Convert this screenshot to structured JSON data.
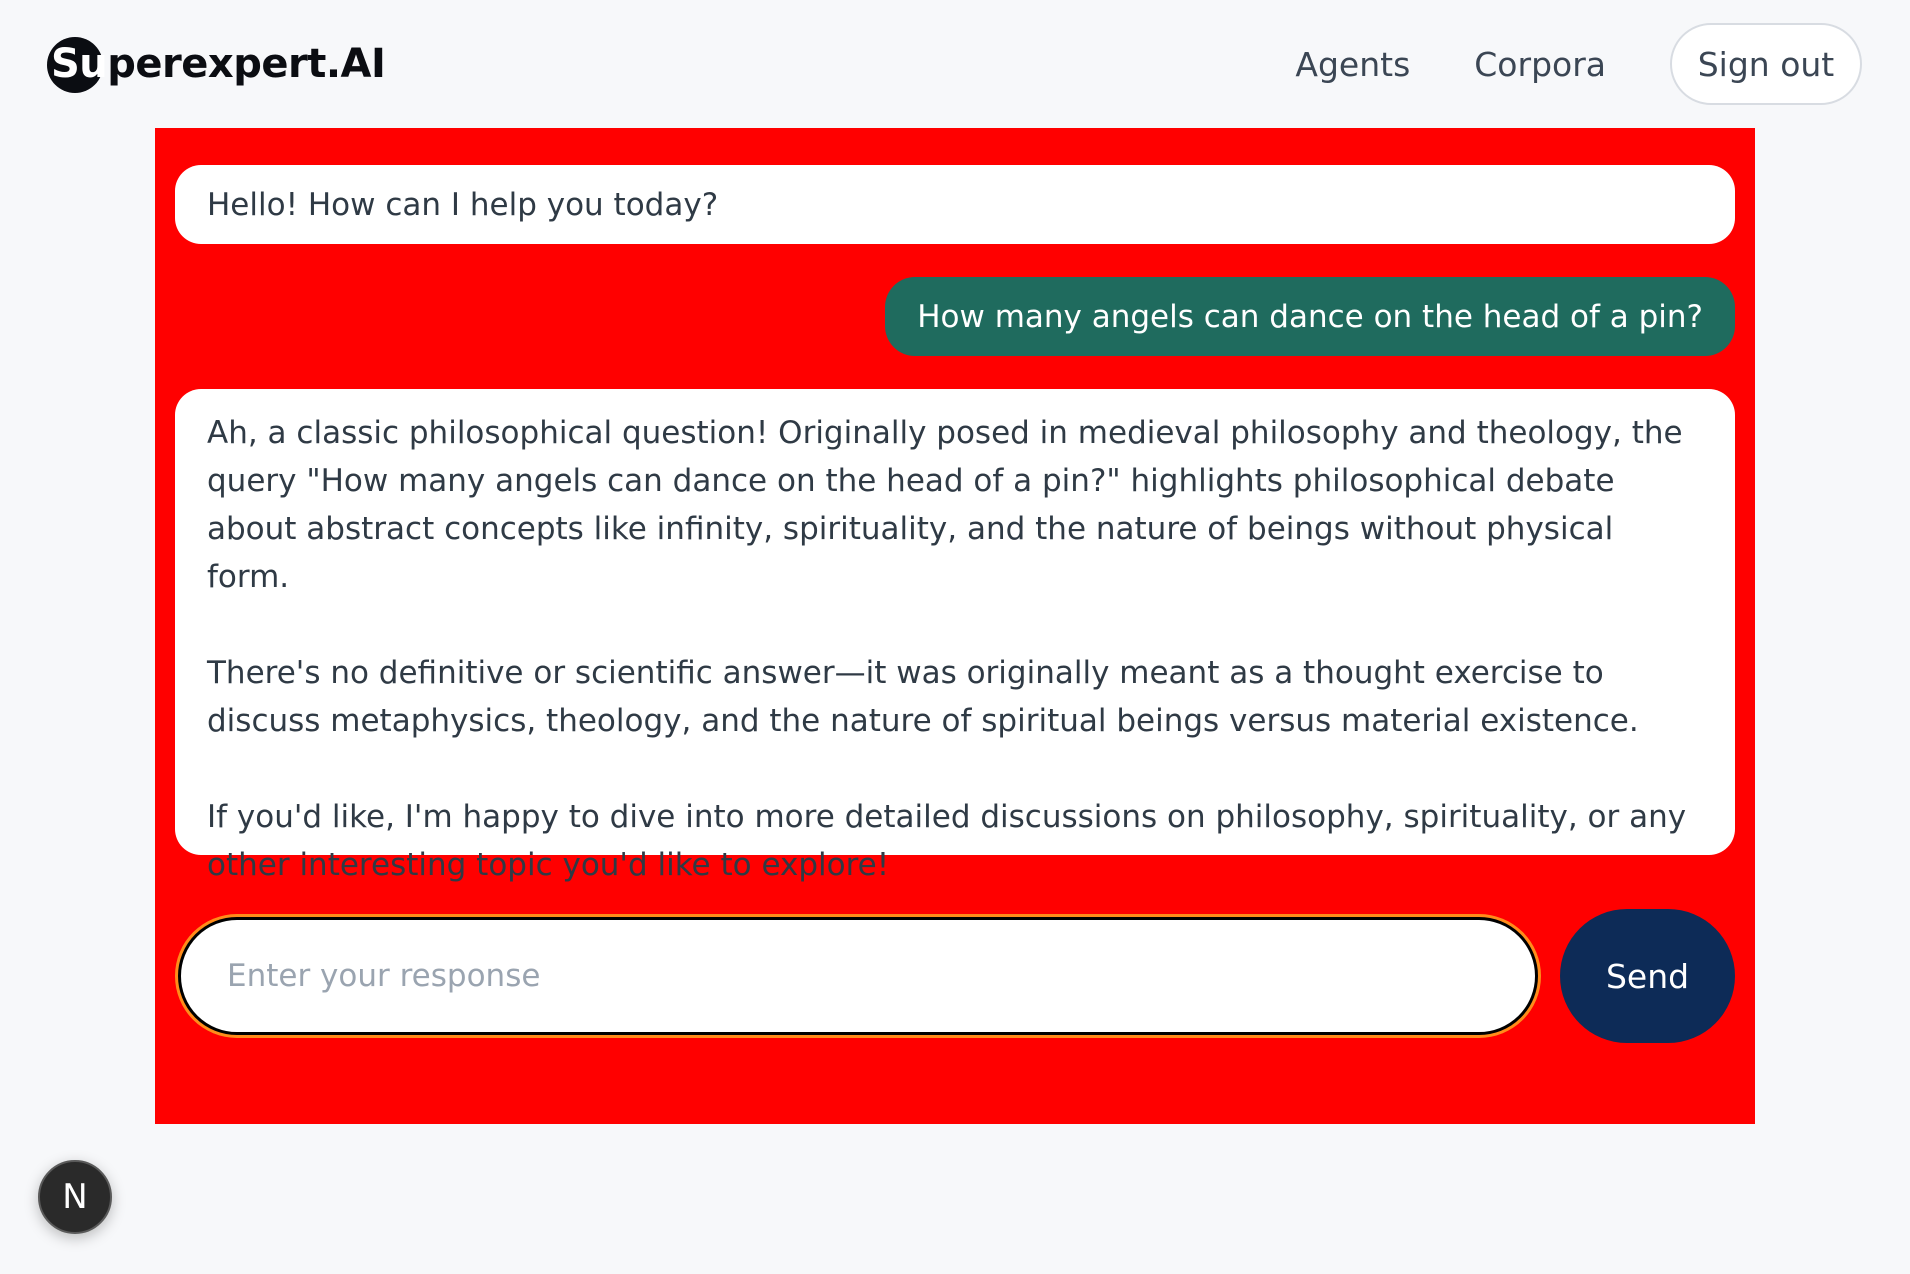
{
  "header": {
    "logo_mark": "Su",
    "logo_rest": "perexpert.AI",
    "nav": [
      {
        "label": "Agents"
      },
      {
        "label": "Corpora"
      }
    ],
    "signout_label": "Sign out"
  },
  "chat": {
    "greeting": "Hello! How can I help you today?",
    "user_message": "How many angels can dance on the head of a pin?",
    "answer_paragraphs": [
      "Ah, a classic philosophical question! Originally posed in medieval philosophy and theology, the query \"How many angels can dance on the head of a pin?\" highlights philosophical debate about abstract concepts like infinity, spirituality, and the nature of beings without physical form.",
      "There's no definitive or scientific answer—it was originally meant as a thought exercise to discuss metaphysics, theology, and the nature of spiritual beings versus material existence.",
      "If you'd like, I'm happy to dive into more detailed discussions on philosophy, spirituality, or any other interesting topic you'd like to explore!"
    ]
  },
  "composer": {
    "placeholder": "Enter your response",
    "value": "",
    "send_label": "Send"
  },
  "dev_badge": {
    "label": "N"
  },
  "colors": {
    "panel_background": "#ff0000",
    "user_bubble": "#1f6b5e",
    "send_button": "#0d2b57",
    "input_focus_ring": "#ff8c1a"
  }
}
